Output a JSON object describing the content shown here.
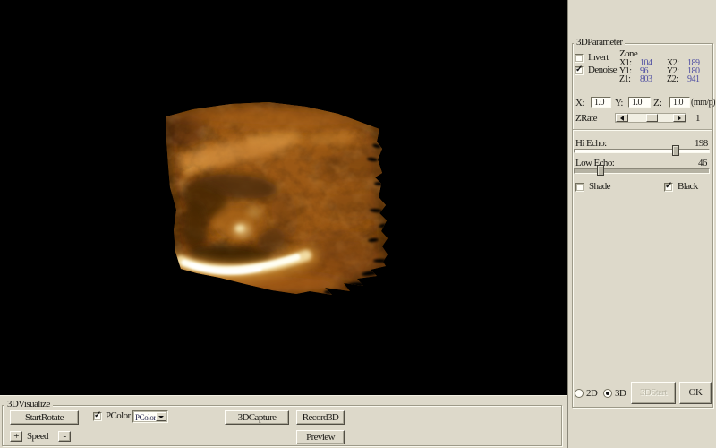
{
  "colors": {
    "panel_bg": "#ddd9ca",
    "viewport_bg": "#000000",
    "value_blue": "#4d4da2",
    "text": "#1b1a16",
    "disabled_text": "#b7b4a4",
    "volume_amber": "#8a4c10"
  },
  "viewport": {
    "description": "3D ultrasound volume rendering, amber-brown textured block on black"
  },
  "panel": {
    "group_title": "3DParameter",
    "invert_label": "Invert",
    "invert_checked": false,
    "denoise_label": "Denoise",
    "denoise_checked": true,
    "zone": {
      "title": "Zone",
      "rows": [
        {
          "l1": "X1:",
          "v1": "104",
          "l2": "X2:",
          "v2": "189"
        },
        {
          "l1": "Y1:",
          "v1": "96",
          "l2": "Y2:",
          "v2": "180"
        },
        {
          "l1": "Z1:",
          "v1": "803",
          "l2": "Z2:",
          "v2": "941"
        }
      ]
    },
    "scale": {
      "x_label": "X:",
      "x_value": "1.0",
      "y_label": "Y:",
      "y_value": "1.0",
      "z_label": "Z:",
      "z_value": "1.0",
      "unit": "(mm/p)"
    },
    "zrate": {
      "label": "ZRate",
      "value": "1"
    },
    "hi_echo": {
      "label": "Hi Echo:",
      "value": "198"
    },
    "low_echo": {
      "label": "Low Echo:",
      "value": "46"
    },
    "shade_label": "Shade",
    "shade_checked": false,
    "black_label": "Black",
    "black_checked": true,
    "mode_2d_label": "2D",
    "mode_3d_label": "3D",
    "mode_selected": "3D",
    "start_button": "3DStart",
    "start_button_enabled": false,
    "ok_button": "OK"
  },
  "bottom": {
    "group_title": "3DVisualize",
    "start_rotate_button": "StartRotate",
    "speed_plus": "+",
    "speed_label": "Speed",
    "speed_minus": "-",
    "pcolor_label": "PColor",
    "pcolor_checked": true,
    "pcolor_combo_value": "PColor",
    "capture_button": "3DCapture",
    "record_button": "Record3D",
    "preview_button": "Preview"
  }
}
